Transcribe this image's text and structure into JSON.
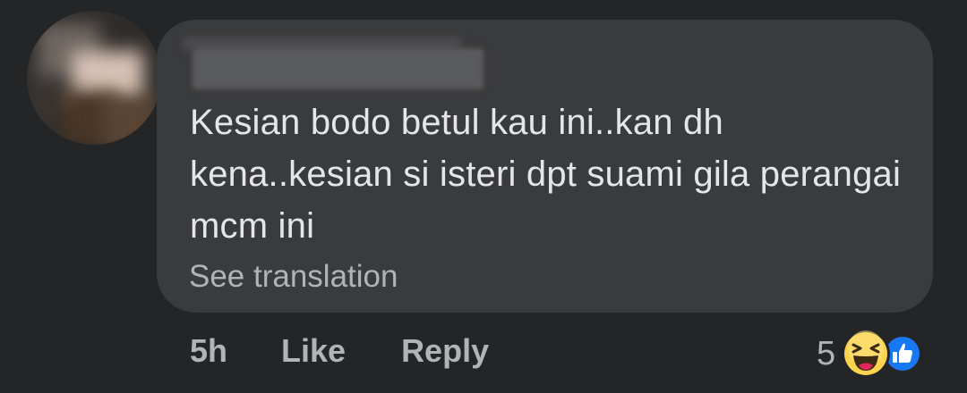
{
  "comment": {
    "author_name": "",
    "text": "Kesian bodo betul kau ini..kan dh kena..kesian si isteri dpt suami gila perangai mcm ini",
    "see_translation_label": "See translation"
  },
  "actions": {
    "timestamp": "5h",
    "like_label": "Like",
    "reply_label": "Reply"
  },
  "reactions": {
    "count": "5",
    "icons": [
      "haha-icon",
      "like-icon"
    ]
  },
  "colors": {
    "background": "#242526",
    "bubble": "#3a3b3c",
    "text": "#e4e6eb",
    "secondary_text": "#b0b3b8",
    "like_blue": "#1877f2",
    "haha_yellow": "#fcd34d"
  }
}
